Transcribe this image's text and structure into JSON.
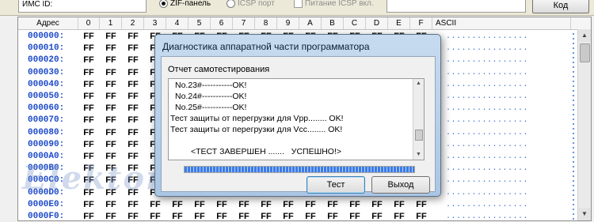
{
  "top": {
    "imc_label": "ИМС ID:",
    "radio_zif": "ZIF-панель",
    "radio_icsp": "ICSP порт",
    "check_power": "Питание ICSP вкл.",
    "kod_button": "Код"
  },
  "grid": {
    "header_addr": "Адрес",
    "header_cols": [
      "0",
      "1",
      "2",
      "3",
      "4",
      "5",
      "6",
      "7",
      "8",
      "9",
      "A",
      "B",
      "C",
      "D",
      "E",
      "F"
    ],
    "header_ascii": "ASCII",
    "addresses": [
      "000000:",
      "000010:",
      "000020:",
      "000030:",
      "000040:",
      "000050:",
      "000060:",
      "000070:",
      "000080:",
      "000090:",
      "0000A0:",
      "0000B0:",
      "0000C0:",
      "0000D0:",
      "0000E0:",
      "0000F0:"
    ],
    "cell_value": "FF",
    "ascii_text": "................"
  },
  "watermark": "Elektor.kz",
  "dialog": {
    "title": "Диагностика аппаратной части программатора",
    "report_label": "Отчет самотестирования",
    "log_lines": [
      "No.23#-----------OK!",
      "No.24#-----------OK!",
      "No.25#-----------OK!",
      "Тест защиты от перегрузки для Vpp........ OK!",
      "Тест защиты от перегрузки для Vcc........ OK!",
      "",
      "<ТЕСТ ЗАВЕРШЕН .......   УСПЕШНО!>"
    ],
    "progress_fraction": 1.0,
    "test_button": "Тест",
    "exit_button": "Выход"
  }
}
